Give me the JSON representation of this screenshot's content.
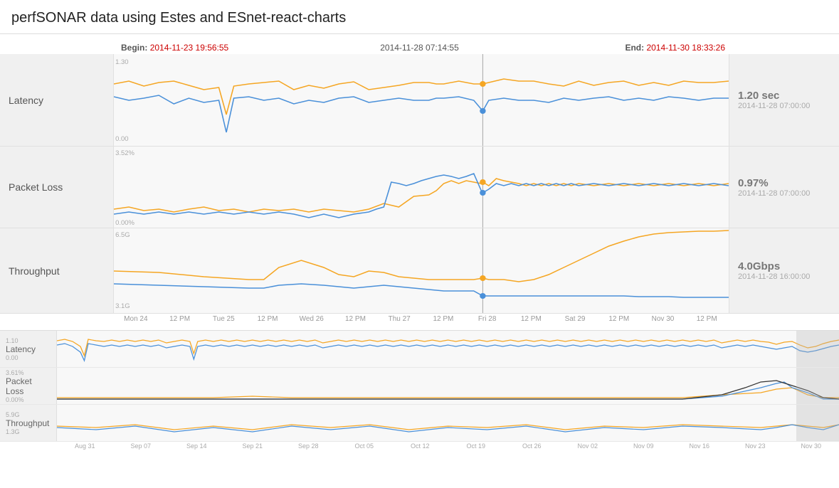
{
  "title": "perfSONAR data using Estes and ESnet-react-charts",
  "header": {
    "begin_label": "Begin:",
    "begin_date": "2014-11-23 19:56:55",
    "center_date": "2014-11-28 07:14:55",
    "end_label": "End:",
    "end_date": "2014-11-30 18:33:26"
  },
  "main_charts": [
    {
      "id": "latency",
      "label": "Latency",
      "y_max": "1.30",
      "y_min": "0.00",
      "info_value": "1.20 sec",
      "info_date": "2014-11-28 07:00:00"
    },
    {
      "id": "packet-loss",
      "label": "Packet Loss",
      "y_max": "3.52%",
      "y_min": "0.00%",
      "info_value": "0.97%",
      "info_date": "2014-11-28 07:00:00"
    },
    {
      "id": "throughput",
      "label": "Throughput",
      "y_max": "6.5G",
      "y_min": "3.1G",
      "info_value": "4.0Gbps",
      "info_date": "2014-11-28 16:00:00"
    }
  ],
  "x_ticks": [
    "Mon 24",
    "12 PM",
    "Tue 25",
    "12 PM",
    "Wed 26",
    "12 PM",
    "Thu 27",
    "12 PM",
    "Fri 28",
    "12 PM",
    "Sat 29",
    "12 PM",
    "Nov 30",
    "12 PM"
  ],
  "mini_charts": [
    {
      "id": "mini-latency",
      "label": "Latency",
      "y_max": "1.10",
      "y_min": "0.00"
    },
    {
      "id": "mini-packet-loss",
      "label": "Packet Loss",
      "y_max": "3.61%",
      "y_min": "0.00%"
    },
    {
      "id": "mini-throughput",
      "label": "Throughput",
      "y_max": "5.9G",
      "y_min": "1.3G"
    }
  ],
  "mini_x_ticks": [
    "Aug 31",
    "Sep 07",
    "Sep 14",
    "Sep 21",
    "Sep 28",
    "Oct 05",
    "Oct 12",
    "Oct 19",
    "Oct 26",
    "Nov 02",
    "Nov 09",
    "Nov 16",
    "Nov 23",
    "Nov 30"
  ]
}
